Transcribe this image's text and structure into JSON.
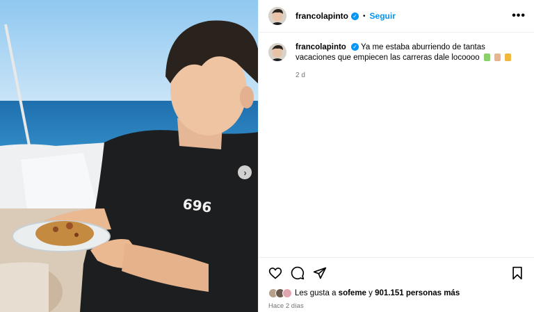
{
  "post": {
    "username": "francolapinto",
    "follow_label": "Seguir",
    "dot": "•",
    "more_icon": "more-options-icon",
    "caption": "Ya me estaba aburriendo de tantas vacaciones que empiecen las carreras dale locoooo",
    "relative_time": "2 d",
    "shirt_text": "696",
    "likes_prefix": "Les gusta a",
    "likes_user": "sofeme",
    "likes_connector": "y",
    "likes_count_text": "901.151 personas más",
    "date_text": "Hace 2 días"
  },
  "icons": [
    "heart-icon",
    "comment-icon",
    "share-icon",
    "bookmark-icon",
    "next-arrow-icon",
    "verified-icon"
  ],
  "colors": {
    "accent": "#0095f6",
    "muted": "#737373",
    "border": "#efefef"
  }
}
